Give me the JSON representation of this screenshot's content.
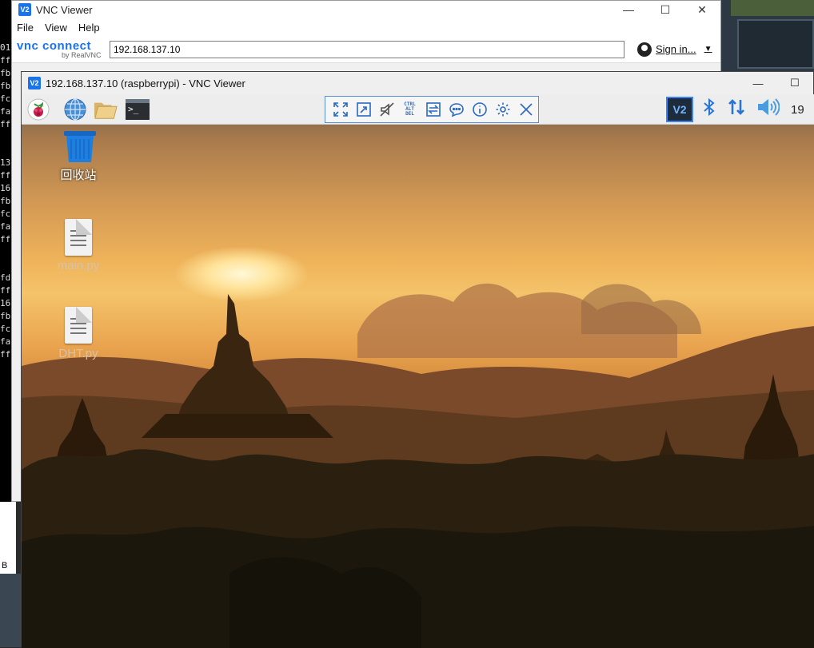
{
  "terminal": {
    "lines": [
      "01",
      "ff",
      "fb",
      "fb",
      "fc",
      "fa",
      "ff",
      "",
      "",
      "13",
      "ff",
      "16",
      "fb",
      "fc",
      "fa",
      "ff",
      "",
      "",
      "fd",
      "ff",
      "16",
      "fb",
      "fc",
      "fa",
      "ff"
    ],
    "bottom_char": "B"
  },
  "viewer": {
    "title": "VNC Viewer",
    "logo": "V2",
    "menu": [
      "File",
      "View",
      "Help"
    ],
    "brand_main": "vnc connect",
    "brand_sub": "by RealVNC",
    "address_value": "192.168.137.10",
    "sign_in": "Sign in...",
    "window_controls": [
      "—",
      "☐",
      "✕"
    ]
  },
  "session": {
    "title": "192.168.137.10 (raspberrypi) - VNC Viewer",
    "window_controls": [
      "—",
      "☐"
    ]
  },
  "taskbar": {
    "icons": [
      "raspberry-menu-icon",
      "web-browser-icon",
      "file-manager-icon",
      "terminal-icon"
    ],
    "terminal_glyph": ">_",
    "vnc_toolbar": [
      "full-screen-icon",
      "scale-icon",
      "audio-mute-icon",
      "ctrl-alt-del-icon",
      "file-transfer-icon",
      "chat-icon",
      "info-icon",
      "settings-icon",
      "close-icon"
    ],
    "cad_text": "CTRL\nALT\nDEL",
    "tray": {
      "vnc_label": "V2",
      "bluetooth": "bluetooth-icon",
      "network": "network-icon",
      "volume": "volume-icon",
      "clock": "19"
    }
  },
  "desktop": {
    "icons": [
      {
        "label": "回收站",
        "icon": "trash-icon"
      },
      {
        "label": "main.py",
        "icon": "file-icon"
      },
      {
        "label": "DHT.py",
        "icon": "file-icon"
      }
    ]
  },
  "colors": {
    "accent": "#1a73e8",
    "vnc_tool": "#2a6ac0"
  }
}
